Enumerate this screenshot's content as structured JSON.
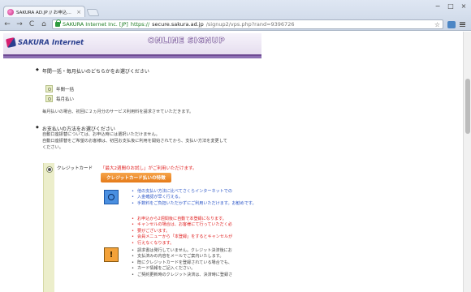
{
  "browser": {
    "tab_title": "SAKURA AD.JP // お申込…",
    "tab_close": "×",
    "window_controls": [
      "−",
      "□",
      "×"
    ],
    "back": "←",
    "forward": "→",
    "reload": "C",
    "home": "⌂",
    "ev_badge": "SAKURA Internet Inc. [JP]",
    "url_scheme": "https://",
    "url_host": "secure.sakura.ad.jp",
    "url_path": "/signup2/vps.php?rand=9396726",
    "bookmark_star": "☆"
  },
  "banner": {
    "logo_text": "SAKURA Internet",
    "online_signup": "ONLINE SIGNUP"
  },
  "payment_cycle": {
    "bullet": "◆",
    "question": "年間一括・毎月払いのどちらかをお選びください",
    "options": [
      "年間一括",
      "毎月払い"
    ],
    "note": "毎月払いの場合、初回に２ヵ月分のサービス利用料を請求させていただきます。"
  },
  "payment_method": {
    "bullet": "◆",
    "question": "お支払いの方法をお選びください",
    "notes": [
      "自動口座振替については、お申込時には選択いただけません。",
      "自動口座振替をご希望のお客様は、初回お支払後に利用を開始されてから、支払い方法を変更して",
      "ください。"
    ],
    "credit_card": {
      "label": "クレジットカード",
      "trial_note": "「最大2週間のお試し」がご利用いただけます。",
      "feature_tag": "クレジットカード払いの特徴",
      "blue_items": [
        "他の支払い方法に比べてさくらインターネットでの",
        "入金確認が早く行える。",
        "手数料をご負担いただかずにご利用いただけます。お勧めです。"
      ],
      "red_items": [
        "お申込から2週間後に自動で本登録になります。",
        "キャンセルの場合は、お客様にて行っていただく必",
        "要がございます。",
        "会員メニューから「本登録」をするとキャンセルが",
        "行えなくなります。"
      ],
      "gray_items": [
        "請求書は発行していません。クレジット決済後にお",
        "支払済みの内容をメールでご案内いたします。",
        "既にクレジットカードを登録されている場合でも、",
        "カード情報をご記入ください。",
        "ご契約更新時のクレジット決済は、決済時に登録さ"
      ]
    }
  }
}
